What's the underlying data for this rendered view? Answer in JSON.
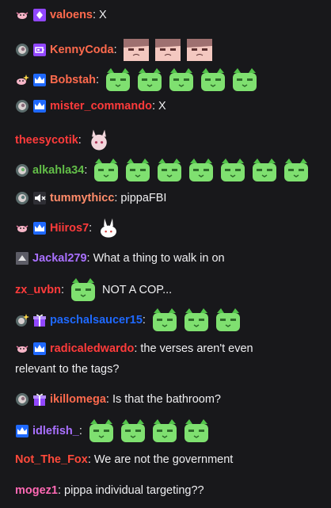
{
  "colors": {
    "background": "#18181b",
    "text": "#efeff1",
    "sub_purple": "#9147ff",
    "sub_blue": "#1f69ff"
  },
  "messages": [
    {
      "username": "valoens",
      "color": "#ff6a4d",
      "badges": [
        "axolotl-pin-icon",
        "purple-gem-icon"
      ],
      "text": "X",
      "emotes": []
    },
    {
      "username": "KennyCoda",
      "color": "#ff6a4d",
      "badges": [
        "shell-badge-icon",
        "purple-battery-icon"
      ],
      "text": "",
      "emotes": [
        "pippa-glare-emote",
        "pippa-glare-emote",
        "pippa-glare-emote"
      ]
    },
    {
      "username": "Bobstah",
      "color": "#ff6a4d",
      "badges": [
        "axolotl-sparkle-icon",
        "prime-crown-icon"
      ],
      "text": "",
      "emotes": [
        "green-cat-emote",
        "green-cat-emote",
        "green-cat-emote",
        "green-cat-emote",
        "green-cat-emote"
      ]
    },
    {
      "username": "mister_commando",
      "color": "#ff3b3b",
      "badges": [
        "shell-badge-icon",
        "prime-crown-icon"
      ],
      "text": "X",
      "emotes": []
    },
    {
      "username": "theesycotik",
      "color": "#ff3b3b",
      "badges": [],
      "text": "",
      "emotes": [
        "bunny-girl-emote"
      ]
    },
    {
      "username": "alkahla34",
      "color": "#62bd48",
      "badges": [
        "shell-badge-icon"
      ],
      "text": "",
      "emotes": [
        "green-cat-emote",
        "green-cat-emote",
        "green-cat-emote",
        "green-cat-emote",
        "green-cat-emote",
        "green-cat-emote",
        "green-cat-emote"
      ]
    },
    {
      "username": "tummythicc",
      "color": "#ff8c6a",
      "badges": [
        "shell-badge-icon",
        "muted-speaker-icon"
      ],
      "text": "pippaFBI",
      "emotes": []
    },
    {
      "username": "Hiiros7",
      "color": "#ff3b3b",
      "badges": [
        "axolotl-pin-icon",
        "prime-crown-icon"
      ],
      "text": "",
      "emotes": [
        "white-bunny-emote"
      ]
    },
    {
      "username": "Jackal279",
      "color": "#a970ff",
      "badges": [
        "grey-triangle-icon"
      ],
      "text": "What a thing to walk in on",
      "emotes": []
    },
    {
      "username": "zx_uvbn",
      "color": "#ff3b3b",
      "badges": [],
      "text": "NOT A COP...",
      "emotes": [
        "green-cat-emote"
      ]
    },
    {
      "username": "paschalsaucer15",
      "color": "#1f69ff",
      "badges": [
        "shell-sparkle-icon",
        "gift-icon"
      ],
      "text": "",
      "emotes": [
        "green-cat-emote",
        "green-cat-emote",
        "green-cat-emote"
      ]
    },
    {
      "username": "radicaledwardo",
      "color": "#ff3b3b",
      "badges": [
        "axolotl-pin-icon",
        "prime-crown-icon"
      ],
      "text": "the verses aren't even",
      "text2": "relevant to the tags?",
      "emotes": []
    },
    {
      "username": "ikillomega",
      "color": "#ff6a4d",
      "badges": [
        "shell-badge-icon",
        "gift-icon"
      ],
      "text": "Is that the bathroom?",
      "emotes": []
    },
    {
      "username": "idlefish_",
      "color": "#a970ff",
      "badges": [
        "prime-crown-icon"
      ],
      "text": "",
      "emotes": [
        "green-cat-emote",
        "green-cat-emote",
        "green-cat-emote",
        "green-cat-emote"
      ]
    },
    {
      "username": "Not_The_Fox",
      "color": "#ff4a3b",
      "badges": [],
      "text": "We are not the government",
      "emotes": []
    },
    {
      "username": "mogez1",
      "color": "#ff69b4",
      "badges": [],
      "text": "pippa individual targeting??",
      "emotes": []
    }
  ]
}
